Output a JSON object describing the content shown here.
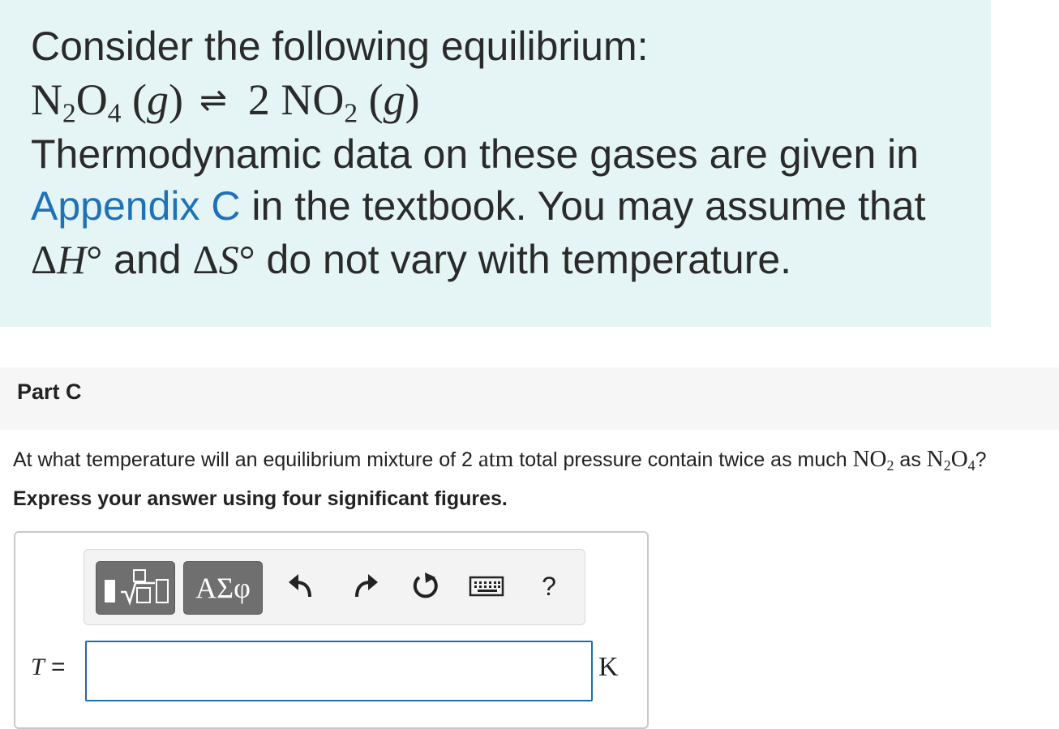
{
  "intro": {
    "line1": "Consider the following equilibrium:",
    "eq_reactant": "N2O4 (g)",
    "eq_arrow": "⇌",
    "eq_product": "2 NO2 (g)",
    "line3": "Thermodynamic data on these gases are given in",
    "link": "Appendix C",
    "line4_rest": " in the textbook. You may assume that",
    "line5_dh": "ΔH°",
    "line5_and": " and ",
    "line5_ds": "ΔS°",
    "line5_rest": " do not vary with temperature."
  },
  "part": {
    "title": "Part C"
  },
  "question": {
    "text_before": "At what temperature will an equilibrium mixture of 2 ",
    "unit_atm": "atm",
    "text_mid": " total pressure contain twice as much ",
    "species1": "NO2",
    "text_as": " as ",
    "species2": "N2O4",
    "text_end": "?"
  },
  "instruction": "Express your answer using four significant figures.",
  "toolbar": {
    "symbols_label": "ΑΣφ",
    "help_label": "?",
    "icons": [
      "templates-icon",
      "undo-icon",
      "redo-icon",
      "reset-icon",
      "keyboard-icon",
      "help-icon"
    ]
  },
  "answer": {
    "label": "T =",
    "value": "",
    "unit": "K"
  },
  "colors": {
    "intro_bg": "#e5f5f5",
    "link": "#1f72b8",
    "input_border": "#1e6fa8",
    "button_bg": "#6f6f6f"
  }
}
